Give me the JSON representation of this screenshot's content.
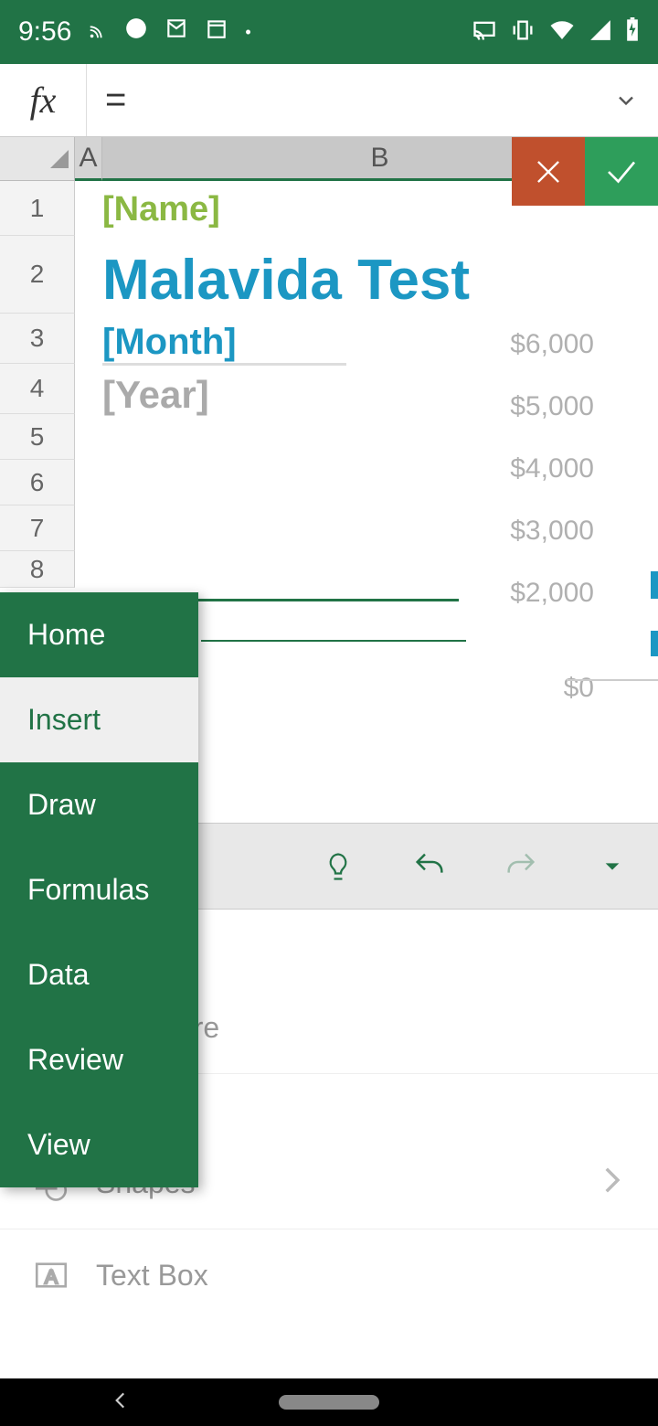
{
  "status": {
    "time": "9:56"
  },
  "formula_bar": {
    "fx": "fx",
    "value": "="
  },
  "columns": [
    "A",
    "B"
  ],
  "rows": [
    "1",
    "2",
    "3",
    "4",
    "5",
    "6",
    "7",
    "8"
  ],
  "sheet": {
    "name_label": "[Name]",
    "title": "Malavida Test",
    "month_label": "[Month]",
    "year_label": "[Year]"
  },
  "chart_data": {
    "type": "bar",
    "yaxis_labels": [
      "$6,000",
      "$5,000",
      "$4,000",
      "$3,000",
      "$2,000",
      "$0"
    ],
    "ylim": [
      0,
      6000
    ],
    "title": "",
    "xlabel": "",
    "ylabel": "",
    "categories": [],
    "values": []
  },
  "ribbon_menu": {
    "items": [
      "Home",
      "Insert",
      "Draw",
      "Formulas",
      "Data",
      "Review",
      "View"
    ],
    "selected_index": 1
  },
  "insert_options": {
    "picture_hint": "m Picture",
    "shapes": "Shapes",
    "textbox": "Text Box"
  }
}
